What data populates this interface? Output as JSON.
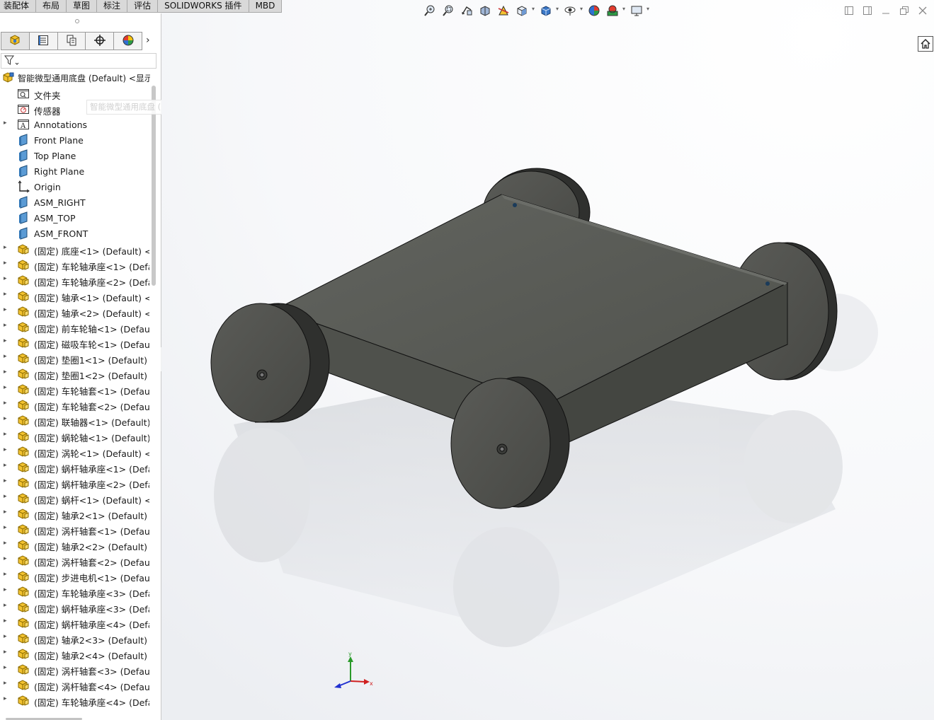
{
  "command_tabs": [
    "装配体",
    "布局",
    "草图",
    "标注",
    "评估",
    "SOLIDWORKS 插件",
    "MBD"
  ],
  "panel_tabs": [
    {
      "icon": "feature-manager-icon"
    },
    {
      "icon": "property-manager-icon"
    },
    {
      "icon": "configuration-manager-icon"
    },
    {
      "icon": "dimxpert-icon"
    },
    {
      "icon": "display-manager-icon"
    }
  ],
  "tree": {
    "root_label": "智能微型通用底盘 (Default) <显示",
    "items": [
      {
        "label": "文件夹",
        "icon": "folder-icon",
        "expandable": false
      },
      {
        "label": "传感器",
        "icon": "sensor-icon",
        "expandable": false
      },
      {
        "label": "Annotations",
        "icon": "annotations-icon",
        "expandable": true
      },
      {
        "label": "Front Plane",
        "icon": "plane-icon",
        "expandable": false
      },
      {
        "label": "Top Plane",
        "icon": "plane-icon",
        "expandable": false
      },
      {
        "label": "Right Plane",
        "icon": "plane-icon",
        "expandable": false
      },
      {
        "label": "Origin",
        "icon": "origin-icon",
        "expandable": false
      },
      {
        "label": "ASM_RIGHT",
        "icon": "plane-icon",
        "expandable": false
      },
      {
        "label": "ASM_TOP",
        "icon": "plane-icon",
        "expandable": false
      },
      {
        "label": "ASM_FRONT",
        "icon": "plane-icon",
        "expandable": false
      },
      {
        "label": "(固定) 底座<1> (Default) <<",
        "icon": "part-icon",
        "expandable": true
      },
      {
        "label": "(固定) 车轮轴承座<1> (Defau",
        "icon": "part-icon",
        "expandable": true
      },
      {
        "label": "(固定) 车轮轴承座<2> (Defau",
        "icon": "part-icon",
        "expandable": true
      },
      {
        "label": "(固定) 轴承<1> (Default) <<",
        "icon": "part-icon",
        "expandable": true
      },
      {
        "label": "(固定) 轴承<2> (Default) <<",
        "icon": "part-icon",
        "expandable": true
      },
      {
        "label": "(固定) 前车轮轴<1> (Default)",
        "icon": "part-icon",
        "expandable": true
      },
      {
        "label": "(固定) 磁吸车轮<1> (Default)",
        "icon": "part-icon",
        "expandable": true
      },
      {
        "label": "(固定) 垫圈1<1> (Default) <·",
        "icon": "part-icon",
        "expandable": true
      },
      {
        "label": "(固定) 垫圈1<2> (Default) <·",
        "icon": "part-icon",
        "expandable": true
      },
      {
        "label": "(固定) 车轮轴套<1> (Default)",
        "icon": "part-icon",
        "expandable": true
      },
      {
        "label": "(固定) 车轮轴套<2> (Default)",
        "icon": "part-icon",
        "expandable": true
      },
      {
        "label": "(固定) 联轴器<1> (Default) <",
        "icon": "part-icon",
        "expandable": true
      },
      {
        "label": "(固定) 蜗轮轴<1> (Default) <",
        "icon": "part-icon",
        "expandable": true
      },
      {
        "label": "(固定) 涡轮<1> (Default) <<",
        "icon": "part-icon",
        "expandable": true
      },
      {
        "label": "(固定) 蜗杆轴承座<1> (Defau",
        "icon": "part-icon",
        "expandable": true
      },
      {
        "label": "(固定) 蜗杆轴承座<2> (Defau",
        "icon": "part-icon",
        "expandable": true
      },
      {
        "label": "(固定) 蜗杆<1> (Default) <<",
        "icon": "part-icon",
        "expandable": true
      },
      {
        "label": "(固定) 轴承2<1> (Default) <·",
        "icon": "part-icon",
        "expandable": true
      },
      {
        "label": "(固定) 涡杆轴套<1> (Default)",
        "icon": "part-icon",
        "expandable": true
      },
      {
        "label": "(固定) 轴承2<2> (Default) <·",
        "icon": "part-icon",
        "expandable": true
      },
      {
        "label": "(固定) 涡杆轴套<2> (Default)",
        "icon": "part-icon",
        "expandable": true
      },
      {
        "label": "(固定) 步进电机<1> (Default)",
        "icon": "part-icon",
        "expandable": true
      },
      {
        "label": "(固定) 车轮轴承座<3> (Defau",
        "icon": "part-icon",
        "expandable": true
      },
      {
        "label": "(固定) 蜗杆轴承座<3> (Defau",
        "icon": "part-icon",
        "expandable": true
      },
      {
        "label": "(固定) 蜗杆轴承座<4> (Defau",
        "icon": "part-icon",
        "expandable": true
      },
      {
        "label": "(固定) 轴承2<3> (Default) <·",
        "icon": "part-icon",
        "expandable": true
      },
      {
        "label": "(固定) 轴承2<4> (Default) <·",
        "icon": "part-icon",
        "expandable": true
      },
      {
        "label": "(固定) 涡杆轴套<3> (Default)",
        "icon": "part-icon",
        "expandable": true
      },
      {
        "label": "(固定) 涡杆轴套<4> (Default)",
        "icon": "part-icon",
        "expandable": true
      },
      {
        "label": "(固定) 车轮轴承座<4> (Defau",
        "icon": "part-icon",
        "expandable": true
      }
    ]
  },
  "tooltip": "智能微型通用底盘 (Default) <显示状态-1>",
  "view_toolbar": [
    {
      "icon": "zoom-to-fit-icon"
    },
    {
      "icon": "zoom-to-area-icon"
    },
    {
      "icon": "previous-view-icon"
    },
    {
      "icon": "section-view-icon"
    },
    {
      "icon": "dynamic-annotation-icon"
    },
    {
      "icon": "view-orientation-icon",
      "dropdown": true
    },
    {
      "icon": "display-style-icon",
      "dropdown": true
    },
    {
      "icon": "hide-show-items-icon",
      "dropdown": true
    },
    {
      "icon": "edit-appearance-icon"
    },
    {
      "icon": "apply-scene-icon",
      "dropdown": true
    },
    {
      "icon": "view-settings-icon",
      "dropdown": true
    }
  ],
  "window_controls": [
    "tile-left-icon",
    "tile-right-icon",
    "minimize-icon",
    "restore-icon",
    "close-icon"
  ],
  "triad": {
    "x": "x",
    "y": "y"
  },
  "colors": {
    "body": "#535550",
    "wheel": "#4e4f4c",
    "tire": "#2e2f2d",
    "panel_border": "#c9c9c9"
  }
}
